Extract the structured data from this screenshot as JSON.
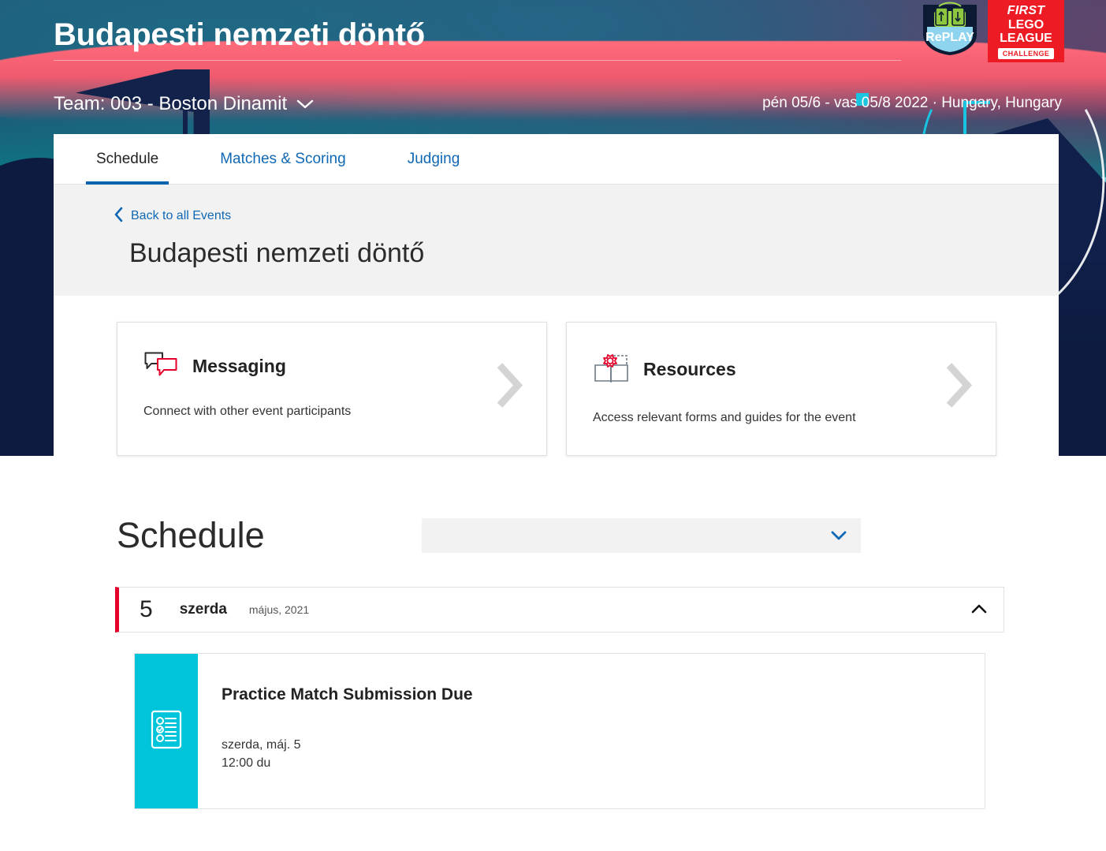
{
  "header": {
    "event_title": "Budapesti nemzeti döntő",
    "team_label": "Team: 003 - Boston Dinamit",
    "team_chevron": "chevron-down",
    "meta": "pén 05/6 - vas 05/8 2022  ·  Hungary, Hungary",
    "logos": {
      "replay_text": "RePLAY",
      "fll_first": "FIRST",
      "fll_lego": "LEGO",
      "fll_league": "LEAGUE",
      "fll_challenge": "CHALLENGE"
    }
  },
  "tabs": [
    {
      "label": "Schedule",
      "active": true
    },
    {
      "label": "Matches & Scoring",
      "active": false
    },
    {
      "label": "Judging",
      "active": false
    }
  ],
  "breadcrumb": {
    "back_label": "Back to all Events",
    "back_chevron": "chevron-left",
    "page_title": "Budapesti nemzeti döntő"
  },
  "cards": [
    {
      "icon": "chat-bubbles-icon",
      "title": "Messaging",
      "subtitle": "Connect with other event participants",
      "arrow": "chevron-right"
    },
    {
      "icon": "gear-book-icon",
      "title": "Resources",
      "subtitle": "Access relevant forms and guides for the event",
      "arrow": "chevron-right"
    }
  ],
  "schedule": {
    "title": "Schedule",
    "filter_value": "",
    "filter_placeholder": "",
    "filter_chevron": "chevron-down",
    "days": [
      {
        "day_number": "5",
        "day_name": "szerda",
        "month_year": "május, 2021",
        "collapse_chevron": "chevron-up",
        "events": [
          {
            "icon": "checklist-icon",
            "title": "Practice Match Submission Due",
            "date": "szerda, máj. 5",
            "time": "12:00 du",
            "accent_color": "#00c4da"
          }
        ]
      }
    ]
  },
  "colors": {
    "link_blue": "#1068b4",
    "tab_underline": "#0b63ad",
    "fll_red": "#ed1c24",
    "day_accent_red": "#e4002b",
    "event_accent_cyan": "#00c4da",
    "panel_gray": "#f2f2f2",
    "bg_navy": "#0d1b40"
  }
}
